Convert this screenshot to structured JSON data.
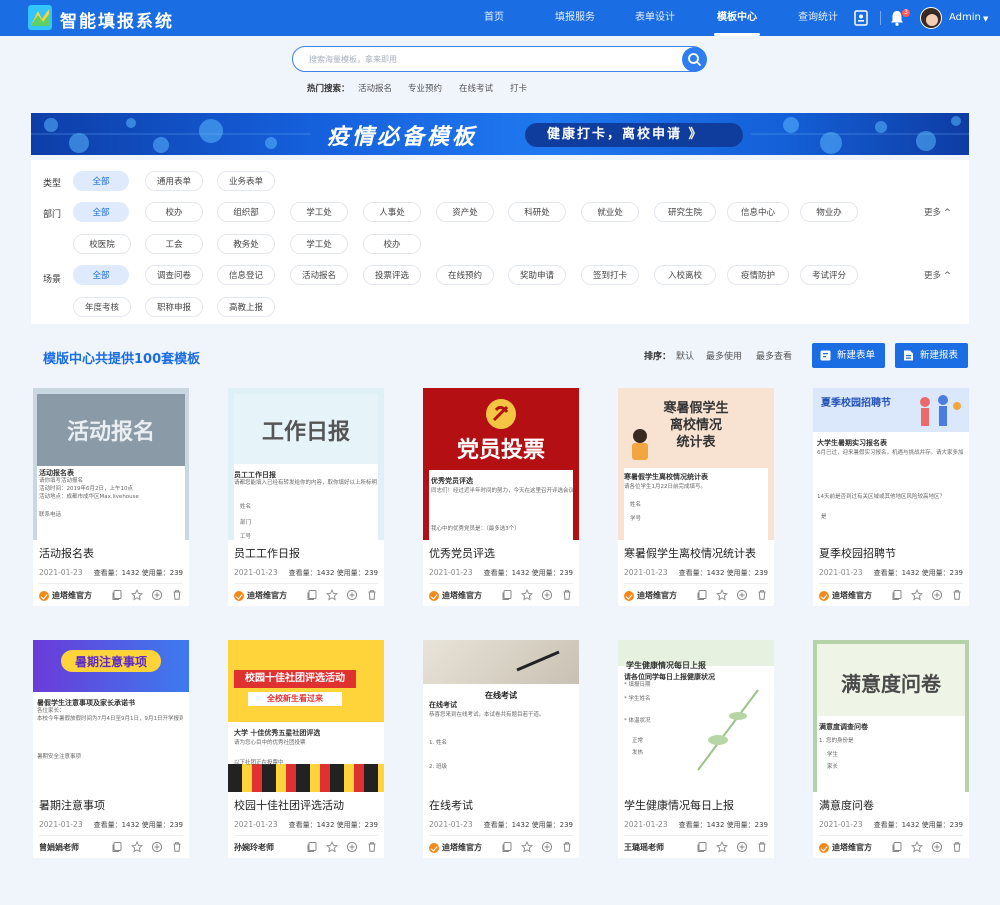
{
  "app": {
    "title": "智能填报系统"
  },
  "nav": [
    {
      "label": "首页",
      "active": false
    },
    {
      "label": "填报服务",
      "active": false
    },
    {
      "label": "表单设计",
      "active": false
    },
    {
      "label": "模板中心",
      "active": true
    },
    {
      "label": "查询统计",
      "active": false
    }
  ],
  "user": {
    "name": "Admin",
    "notifications": "3"
  },
  "search": {
    "placeholder": "搜索海量模板，拿来即用",
    "hot_label": "热门搜索：",
    "hot": [
      "活动报名",
      "专业预约",
      "在线考试",
      "打卡"
    ]
  },
  "banner": {
    "title": "疫情必备模板",
    "pill": "健康打卡，离校申请 》"
  },
  "filters": {
    "type": {
      "label": "类型",
      "options": [
        "全部",
        "通用表单",
        "业务表单"
      ]
    },
    "dept": {
      "label": "部门",
      "options": [
        "全部",
        "校办",
        "组织部",
        "学工处",
        "人事处",
        "资产处",
        "科研处",
        "就业处",
        "研究生院",
        "信息中心",
        "物业办",
        "校医院",
        "工会",
        "教务处",
        "学工处",
        "校办"
      ],
      "more": "更多 ^"
    },
    "scene": {
      "label": "场景",
      "options": [
        "全部",
        "调查问卷",
        "信息登记",
        "活动报名",
        "投票评选",
        "在线预约",
        "奖助申请",
        "签到打卡",
        "入校离校",
        "疫情防护",
        "考试评分",
        "年度考核",
        "职称申报",
        "高教上报"
      ],
      "more": "更多 ^"
    }
  },
  "list": {
    "title": "模版中心共提供100套模板",
    "sort_label": "排序：",
    "sort_options": [
      "默认",
      "最多使用",
      "最多查看"
    ],
    "new_form": "新建表单",
    "new_report": "新建报表"
  },
  "cards": [
    {
      "title": "活动报名表",
      "date": "2021-01-23",
      "stats": "查看量：1432  使用量：239",
      "author": "迪塔维官方",
      "official": true,
      "thumb": {
        "headline": "活动报名",
        "lines": [
          "活动报名表",
          "请你填写活动报名",
          "活动时间：2019年6月2日，上午10点",
          "活动地点：成都市成华区Max.livehouse",
          "联系电话"
        ]
      }
    },
    {
      "title": "员工工作日报",
      "date": "2021-01-23",
      "stats": "查看量：1432  使用量：239",
      "author": "迪塔维官方",
      "official": true,
      "thumb": {
        "headline": "工作日报",
        "lines": [
          "员工工作日报",
          "请都您能填入已经有转发给你的内容，取你填好以上所标明",
          "姓名",
          "部门",
          "工号"
        ]
      }
    },
    {
      "title": "优秀党员评选",
      "date": "2021-01-23",
      "stats": "查看量：1432  使用量：239",
      "author": "迪塔维官方",
      "official": true,
      "thumb": {
        "headline": "党员投票",
        "lines": [
          "优秀党员评选",
          "同志们！经过近半年时间的努力，今天在这里召开评选会议",
          "我心中的优秀党员是：（最多选3个）"
        ]
      }
    },
    {
      "title": "寒暑假学生离校情况统计表",
      "date": "2021-01-23",
      "stats": "查看量：1432  使用量：239",
      "author": "迪塔维官方",
      "official": true,
      "thumb": {
        "headline": "寒暑假学生\n离校情况\n统计表",
        "lines": [
          "寒暑假学生离校情况统计表",
          "请各位学生1月22日前完成填写。",
          "姓名",
          "学号"
        ]
      }
    },
    {
      "title": "夏季校园招聘节",
      "date": "2021-01-23",
      "stats": "查看量：1432  使用量：239",
      "author": "迪塔维官方",
      "official": true,
      "thumb": {
        "headline": "夏季校园招聘节",
        "lines": [
          "大学生暑期实习报名表",
          "6月已过，迎来暑假实习报名，机遇与挑战并存。请大家多加注意。",
          "14天前是否到过有关区域或其他地区风险较高地区？",
          "是"
        ]
      }
    },
    {
      "title": "暑期注意事项",
      "date": "2021-01-23",
      "stats": "查看量：1432  使用量：239",
      "author": "曾娟娟老师",
      "official": false,
      "thumb": {
        "headline": "暑期注意事项",
        "lines": [
          "暑假学生注意事项及家长承诺书",
          "各位家长：",
          "本校今年暑假放假时间为7月4日至9月1日，9月1日开学报到",
          "暑期安全注意事项"
        ]
      }
    },
    {
      "title": "校园十佳社团评选活动",
      "date": "2021-01-23",
      "stats": "查看量：1432  使用量：239",
      "author": "孙婉玲老师",
      "official": false,
      "thumb": {
        "headline": "校园十佳社团评选活动",
        "sub": "全校新生看过来",
        "lines": [
          "大学 十佳优秀五星社团评选",
          "请为您心目中的优秀社团投票",
          "以下社团正在投票中"
        ]
      }
    },
    {
      "title": "在线考试",
      "date": "2021-01-23",
      "stats": "查看量：1432  使用量：239",
      "author": "迪塔维官方",
      "official": true,
      "thumb": {
        "headline": "在线考试",
        "lines": [
          "在线考试",
          "恭喜您来到在线考试，本试卷共有题目若干道。",
          "1. 姓名",
          "2. 班级"
        ]
      }
    },
    {
      "title": "学生健康情况每日上报",
      "date": "2021-01-23",
      "stats": "查看量：1432  使用量：239",
      "author": "王璐瑶老师",
      "official": false,
      "thumb": {
        "headline": "学生健康情况每日上报",
        "lines": [
          "请各位同学每日上报健康状况",
          "* 填报日期",
          "* 学生姓名",
          "* 体温状况",
          "正常",
          "发热"
        ]
      }
    },
    {
      "title": "满意度问卷",
      "date": "2021-01-23",
      "stats": "查看量：1432  使用量：239",
      "author": "迪塔维官方",
      "official": true,
      "thumb": {
        "headline": "满意度问卷",
        "lines": [
          "满意度调查问卷",
          "1. 您的身份是",
          "学生",
          "家长"
        ]
      }
    }
  ],
  "colors": {
    "primary": "#1b6de3",
    "chip_active_bg": "#dfebfd",
    "official_icon": "#f08a1c"
  }
}
